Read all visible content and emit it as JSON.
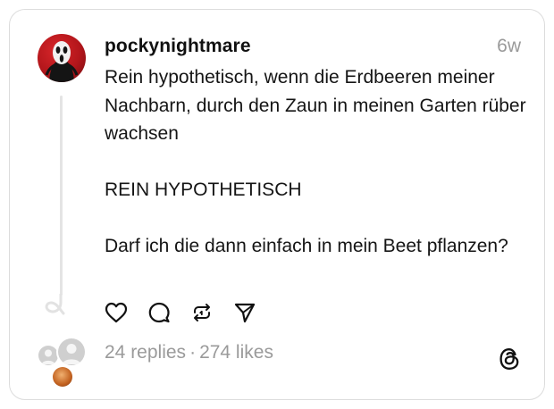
{
  "post": {
    "username": "pockynightmare",
    "timestamp": "6w",
    "text": "Rein hypothetisch, wenn die Erdbeeren meiner Nachbarn, durch den Zaun in meinen Garten rüber wachsen\n\nREIN HYPOTHETISCH\n\nDarf ich die dann einfach in mein Beet pflanzen?",
    "replies": "24 replies",
    "separator": "·",
    "likes": "274 likes"
  },
  "icons": {
    "like": "heart-icon",
    "reply": "comment-icon",
    "repost": "repost-icon",
    "share": "send-icon",
    "brand": "threads-logo"
  },
  "colors": {
    "avatar_red": "#c41a1f",
    "muted_text": "#9a9a9a",
    "border": "#dcdcdc"
  }
}
